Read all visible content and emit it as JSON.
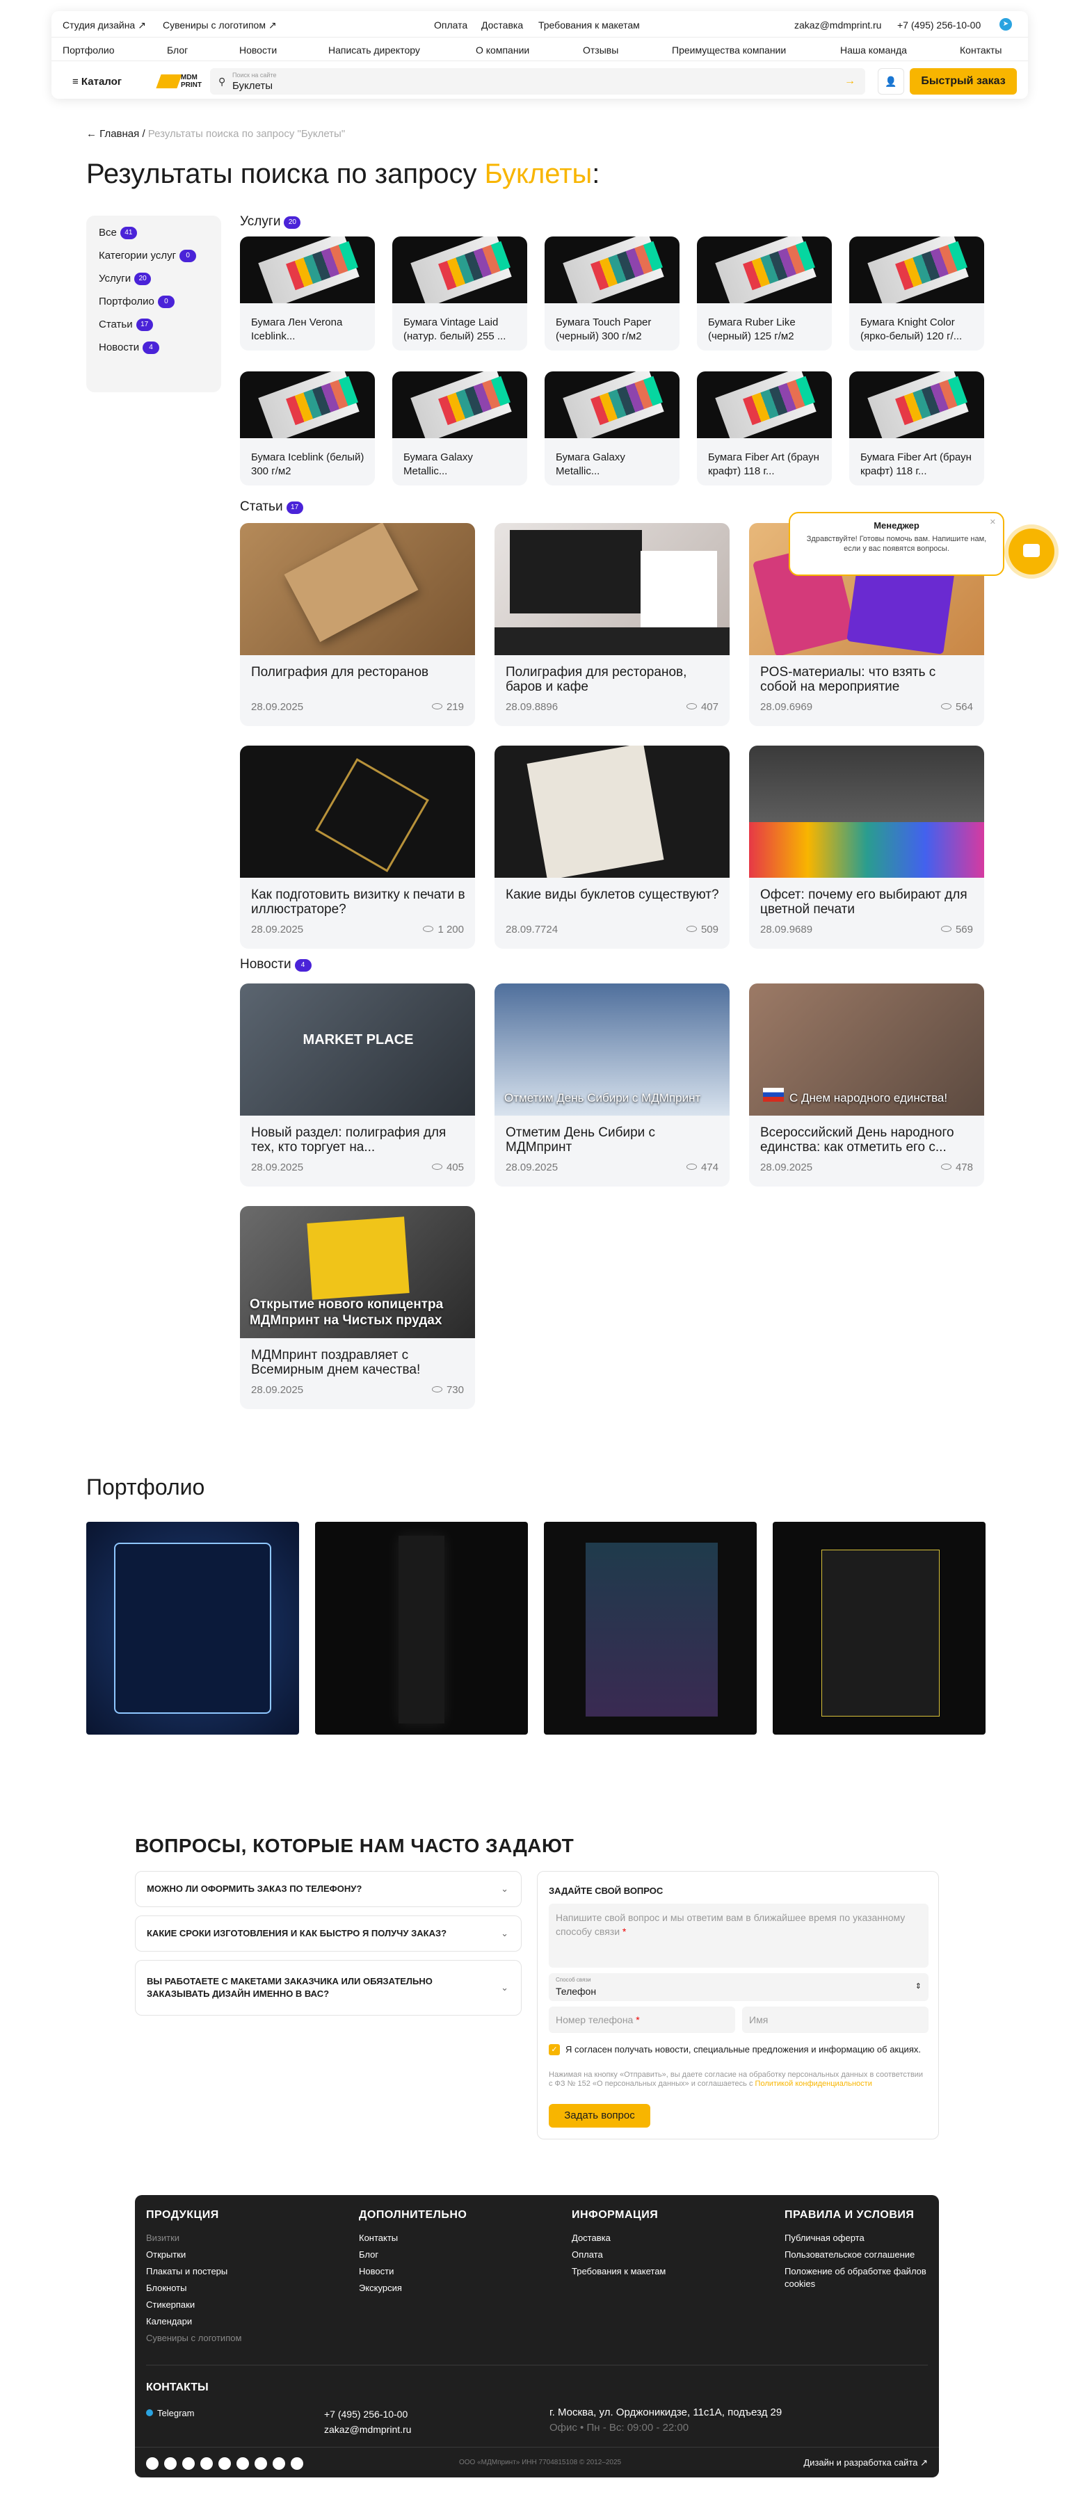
{
  "header": {
    "top_links": [
      "Студия дизайна ↗",
      "Сувениры с логотипом ↗",
      "Оплата",
      "Доставка",
      "Требования к макетам",
      "zakaz@mdmprint.ru",
      "+7 (495) 256-10-00"
    ],
    "nav": [
      "Портфолио",
      "Блог",
      "Новости",
      "Написать директору",
      "О компании",
      "Отзывы",
      "Преимущества компании",
      "Наша команда",
      "Контакты"
    ],
    "catalog": "Каталог",
    "logo_text": "MDM PRINT",
    "search_placeholder": "Поиск на сайте",
    "search_value": "Буклеты",
    "quick_order": "Быстрый заказ"
  },
  "breadcrumb": {
    "home": "Главная",
    "sep": "/",
    "current": "Результаты поиска по запросу \"Буклеты\""
  },
  "title": {
    "prefix": "Результаты поиска по запросу ",
    "query": "Буклеты",
    "suffix": ":"
  },
  "filters": [
    {
      "label": "Все",
      "count": "41"
    },
    {
      "label": "Категории услуг",
      "count": "0"
    },
    {
      "label": "Услуги",
      "count": "20"
    },
    {
      "label": "Портфолио",
      "count": "0"
    },
    {
      "label": "Статьи",
      "count": "17"
    },
    {
      "label": "Новости",
      "count": "4"
    }
  ],
  "services": {
    "heading": "Услуги",
    "count": "20",
    "items": [
      "Бумага Лен Verona Iceblink...",
      "Бумага Vintage Laid (натур. белый) 255 ...",
      "Бумага Touch Paper (черный) 300 г/м2",
      "Бумага Ruber Like (черный) 125 г/м2",
      "Бумага Knight Color (ярко-белый) 120 г/...",
      "Бумага Iceblink (белый) 300 г/м2",
      "Бумага Galaxy Metallic...",
      "Бумага Galaxy Metallic...",
      "Бумага Fiber Art (браун крафт) 118 г...",
      "Бумага Fiber Art (браун крафт) 118 г..."
    ]
  },
  "articles": {
    "heading": "Статьи",
    "count": "17",
    "items": [
      {
        "title": "Полиграфия для ресторанов",
        "date": "28.09.2025",
        "views": "219"
      },
      {
        "title": "Полиграфия для ресторанов, баров и кафе",
        "date": "28.09.8896",
        "views": "407"
      },
      {
        "title": "POS-материалы: что взять с собой на мероприятие",
        "date": "28.09.6969",
        "views": "564"
      },
      {
        "title": "Как подготовить визитку к печати в иллюстраторе?",
        "date": "28.09.2025",
        "views": "1 200"
      },
      {
        "title": "Какие виды буклетов существуют?",
        "date": "28.09.7724",
        "views": "509"
      },
      {
        "title": "Офсет: почему его выбирают для цветной печати",
        "date": "28.09.9689",
        "views": "569"
      }
    ]
  },
  "news": {
    "heading": "Новости",
    "count": "4",
    "items": [
      {
        "title": "Новый раздел: полиграфия для тех, кто торгует на...",
        "date": "28.09.2025",
        "views": "405",
        "overlay": "MARKET PLACE"
      },
      {
        "title": "Отметим День Сибири с МДМпринт",
        "date": "28.09.2025",
        "views": "474",
        "overlay": "Отметим День Сибири с МДМпринт"
      },
      {
        "title": "Всероссийский День народного единства: как отметить его с...",
        "date": "28.09.2025",
        "views": "478",
        "overlay": "С Днем народного единства!"
      },
      {
        "title": "МДМпринт поздравляет с Всемирным днем качества!",
        "date": "28.09.2025",
        "views": "730",
        "overlay": "Открытие нового копицентра МДМпринт на Чистых прудах"
      }
    ]
  },
  "chat": {
    "manager": "Менеджер",
    "text": "Здравствуйте! Готовы помочь вам. Напишите нам, если у вас появятся вопросы."
  },
  "portfolio": {
    "heading": "Портфолио"
  },
  "faq": {
    "heading": "ВОПРОСЫ, КОТОРЫЕ НАМ ЧАСТО ЗАДАЮТ",
    "questions": [
      "МОЖНО ЛИ ОФОРМИТЬ ЗАКАЗ ПО ТЕЛЕФОНУ?",
      "КАКИЕ СРОКИ ИЗГОТОВЛЕНИЯ И КАК БЫСТРО Я ПОЛУЧУ ЗАКАЗ?",
      "ВЫ РАБОТАЕТЕ С МАКЕТАМИ ЗАКАЗЧИКА ИЛИ ОБЯЗАТЕЛЬНО ЗАКАЗЫВАТЬ ДИЗАЙН ИМЕННО В ВАС?"
    ]
  },
  "form": {
    "heading": "ЗАДАЙТЕ СВОЙ ВОПРОС",
    "message_placeholder": "Напишите свой вопрос и мы ответим вам в ближайшее время по указанному способу связи",
    "method_label": "Способ связи",
    "method_value": "Телефон",
    "phone_placeholder": "Номер телефона",
    "name_placeholder": "Имя",
    "consent": "Я согласен получать новости, специальные предложения и информацию об акциях.",
    "legal": "Нажимая на кнопку «Отправить», вы даете согласие на обработку персональных данных в соответствии с ФЗ № 152 «О персональных данных» и соглашаетесь с",
    "legal_link": "Политикой конфиденциальности",
    "submit": "Задать вопрос"
  },
  "footer": {
    "columns": [
      {
        "title": "ПРОДУКЦИЯ",
        "items": [
          "Визитки",
          "Открытки",
          "Плакаты и постеры",
          "Блокноты",
          "Стикерпаки",
          "Календари",
          "Сувениры с логотипом"
        ]
      },
      {
        "title": "ДОПОЛНИТЕЛЬНО",
        "items": [
          "Контакты",
          "Блог",
          "Новости",
          "Экскурсия"
        ]
      },
      {
        "title": "ИНФОРМАЦИЯ",
        "items": [
          "Доставка",
          "Оплата",
          "Требования к макетам"
        ]
      },
      {
        "title": "ПРАВИЛА И УСЛОВИЯ",
        "items": [
          "Публичная оферта",
          "Пользовательское соглашение",
          "Положение об обработке файлов cookies"
        ]
      }
    ],
    "contacts_title": "КОНТАКТЫ",
    "telegram": "Telegram",
    "phone": "+7 (495) 256-10-00",
    "email": "zakaz@mdmprint.ru",
    "address": "г. Москва, ул. Орджоникидзе, 11с1А, подъезд 29",
    "hours": "Офис • Пн - Вс: 09:00 - 22:00",
    "copyright": "ООО «МДМпринт»   ИНН 7704815108   © 2012–2025",
    "dev": "Дизайн и разработка сайта ↗"
  }
}
